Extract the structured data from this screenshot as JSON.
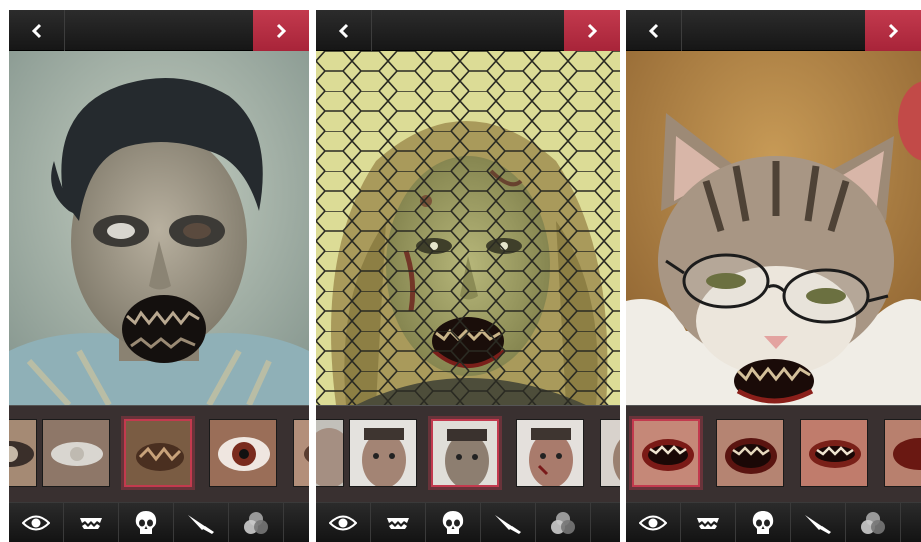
{
  "screens": [
    {
      "name": "zombie-eyes-screen",
      "title": "",
      "photo": "zombie-man-photo",
      "category": "eyes",
      "thumbnails": [
        "eye-thumb-1",
        "eye-thumb-2",
        "eye-thumb-3",
        "eye-thumb-4",
        "eye-thumb-5"
      ],
      "selected_thumbnail": 3
    },
    {
      "name": "zombie-face-screen",
      "title": "",
      "photo": "zombie-woman-fence-photo",
      "category": "face",
      "thumbnails": [
        "face-thumb-1",
        "face-thumb-2",
        "face-thumb-3",
        "face-thumb-4",
        "face-thumb-5"
      ],
      "selected_thumbnail": 3
    },
    {
      "name": "zombie-mouth-screen",
      "title": "",
      "photo": "zombie-cat-photo",
      "category": "mouth",
      "thumbnails": [
        "mouth-thumb-1",
        "mouth-thumb-2",
        "mouth-thumb-3",
        "mouth-thumb-4"
      ],
      "selected_thumbnail": 1
    }
  ],
  "nav": {
    "back_icon": "chevron-left-icon",
    "next_icon": "chevron-right-icon"
  },
  "toolbar_tools": [
    "eye-icon",
    "teeth-icon",
    "skull-icon",
    "knife-icon",
    "overlay-icon"
  ],
  "colors": {
    "accent": "#b52d42",
    "bar": "#1c1c1c",
    "strip": "#3e3434"
  }
}
